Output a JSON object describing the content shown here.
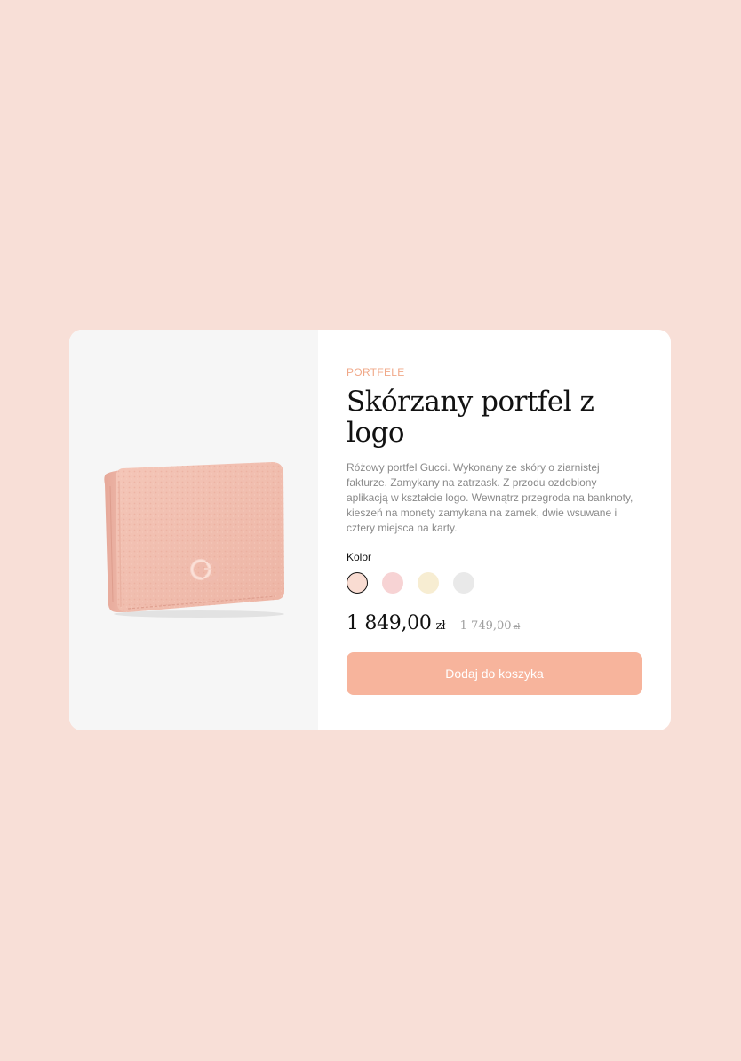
{
  "product": {
    "category": "PORTFELE",
    "title": "Skórzany portfel z logo",
    "description": "Różowy portfel Gucci. Wykonany ze skóry o ziarnistej fakturze. Zamykany na zatrzask. Z przodu ozdobiony aplikacją w kształcie logo. Wewnątrz przegroda na banknoty, kieszeń na monety zamykana na zamek, dwie wsuwane i cztery miejsca na karty.",
    "image_alt": "pink-leather-wallet"
  },
  "color": {
    "label": "Kolor",
    "options": [
      {
        "name": "peach",
        "hex": "#F9DCD2",
        "selected": true
      },
      {
        "name": "pink",
        "hex": "#F7D3D4",
        "selected": false
      },
      {
        "name": "cream",
        "hex": "#F7EDD2",
        "selected": false
      },
      {
        "name": "grey",
        "hex": "#E9E9E9",
        "selected": false
      }
    ]
  },
  "price": {
    "current": "1 849,00",
    "current_currency": "zł",
    "old": "1 749,00",
    "old_currency": "zł"
  },
  "cta": {
    "label": "Dodaj do koszyka"
  },
  "colors": {
    "page_background": "#F8DFD7",
    "card_background": "#FFFFFF",
    "image_background": "#F6F6F6",
    "accent": "#F7B49C",
    "category_text": "#F0A888"
  }
}
